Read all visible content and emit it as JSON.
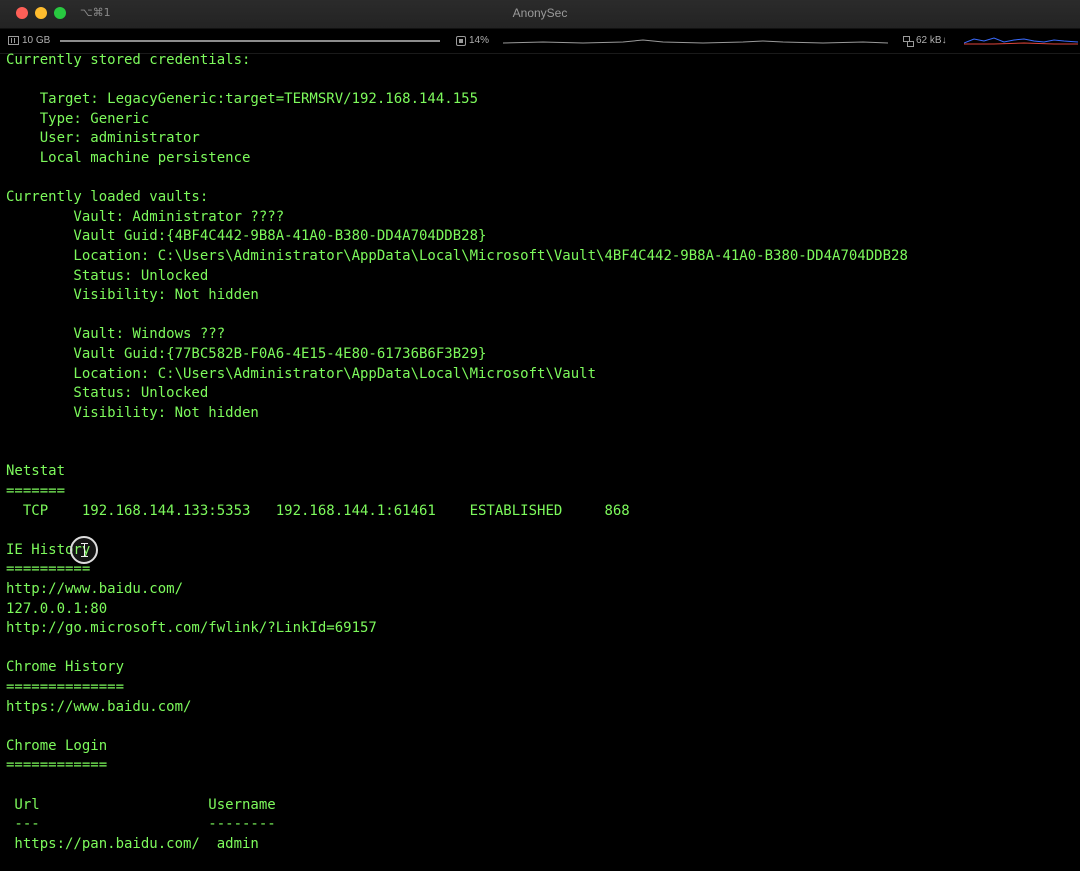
{
  "window": {
    "title": "AnonySec",
    "shortcut": "⌥⌘1"
  },
  "status": {
    "memory": "10 GB",
    "cpu": "14%",
    "network": "62 kB↓",
    "colors": {
      "memory_bar": "#8c8c8c",
      "cpu_graph": "#9a9a9a",
      "net_down": "#3b6cff",
      "net_up": "#e0453b"
    }
  },
  "terminal": {
    "text_color": "#7dfa5c",
    "lines": [
      "Currently stored credentials:",
      "",
      "    Target: LegacyGeneric:target=TERMSRV/192.168.144.155",
      "    Type: Generic",
      "    User: administrator",
      "    Local machine persistence",
      "",
      "Currently loaded vaults:",
      "        Vault: Administrator ????",
      "        Vault Guid:{4BF4C442-9B8A-41A0-B380-DD4A704DDB28}",
      "        Location: C:\\Users\\Administrator\\AppData\\Local\\Microsoft\\Vault\\4BF4C442-9B8A-41A0-B380-DD4A704DDB28",
      "        Status: Unlocked",
      "        Visibility: Not hidden",
      "",
      "        Vault: Windows ???",
      "        Vault Guid:{77BC582B-F0A6-4E15-4E80-61736B6F3B29}",
      "        Location: C:\\Users\\Administrator\\AppData\\Local\\Microsoft\\Vault",
      "        Status: Unlocked",
      "        Visibility: Not hidden",
      "",
      "",
      "Netstat",
      "=======",
      "  TCP    192.168.144.133:5353   192.168.144.1:61461    ESTABLISHED     868",
      "",
      "IE History",
      "==========",
      "http://www.baidu.com/",
      "127.0.0.1:80",
      "http://go.microsoft.com/fwlink/?LinkId=69157",
      "",
      "Chrome History",
      "==============",
      "https://www.baidu.com/",
      "",
      "Chrome Login",
      "============",
      "",
      " Url                    Username",
      " ---                    --------",
      " https://pan.baidu.com/  admin"
    ]
  }
}
